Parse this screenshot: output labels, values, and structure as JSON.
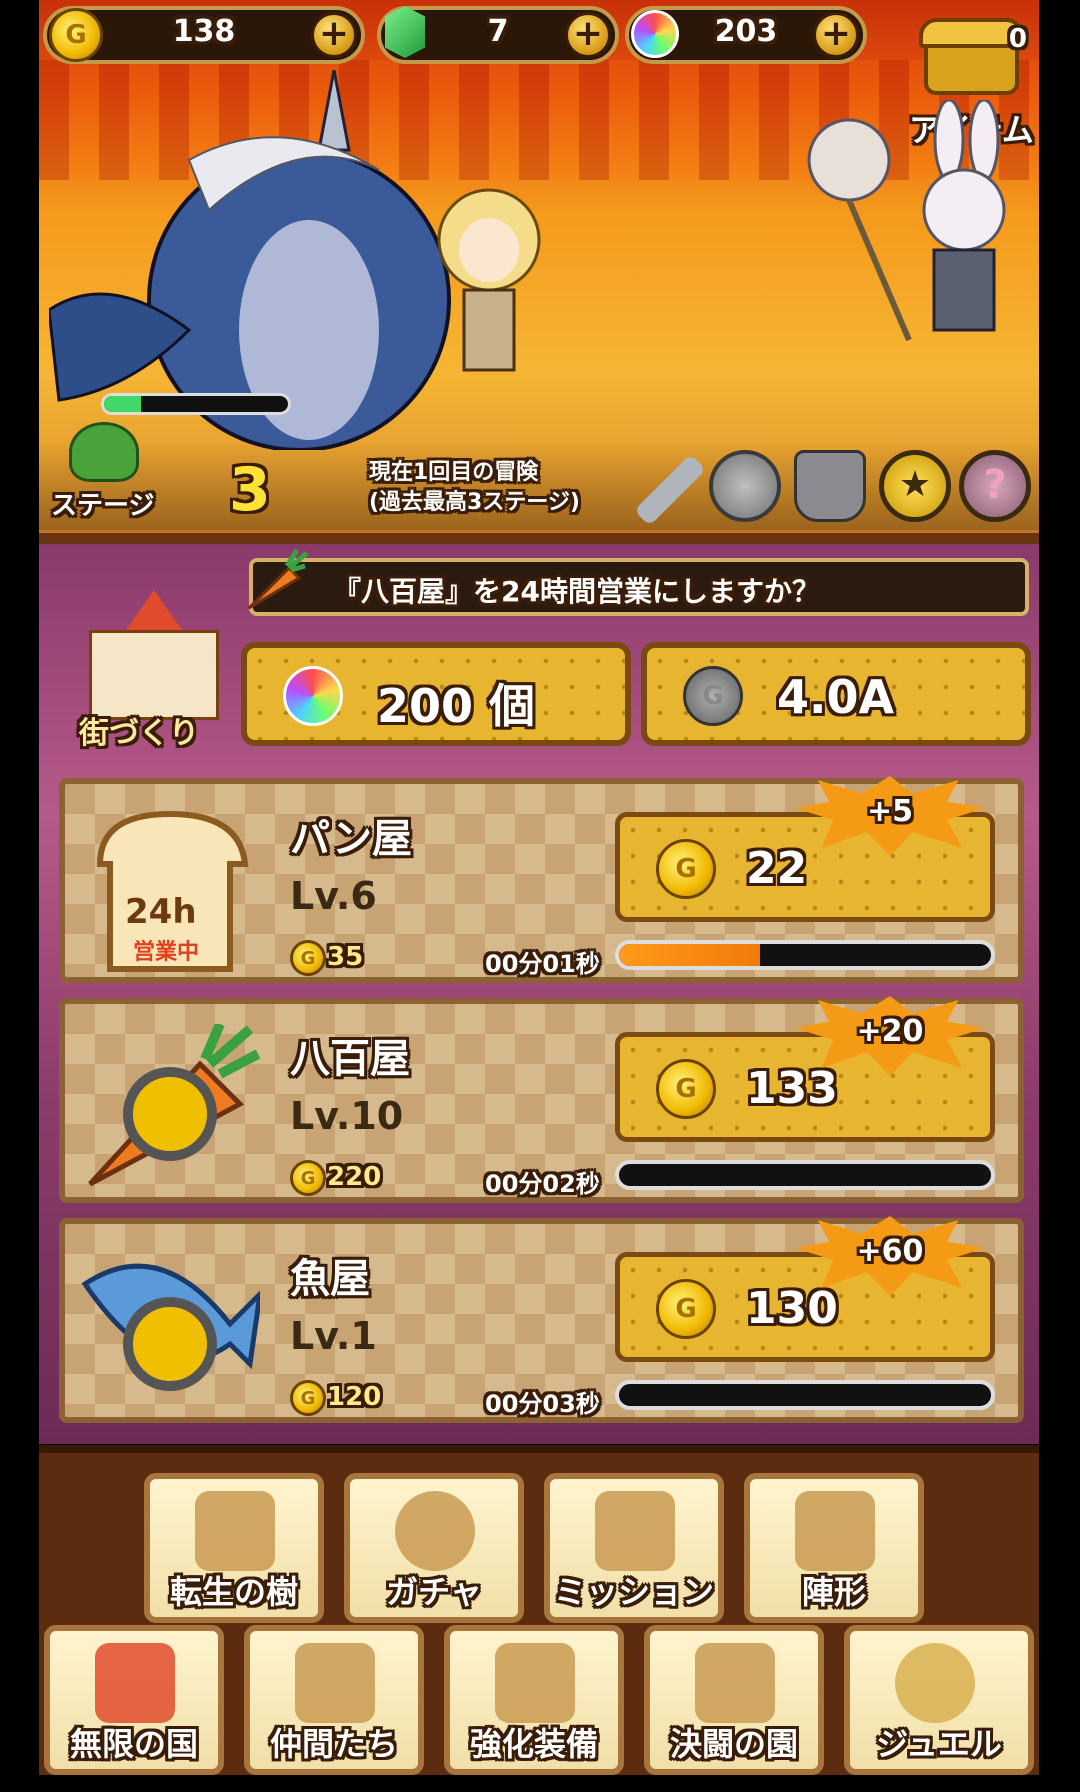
{
  "currency": {
    "coins": "138",
    "gems": "7",
    "rainbow": "203",
    "coin_symbol": "G"
  },
  "chest": {
    "count": "0",
    "label": "アイテム"
  },
  "battle": {
    "stage_label": "ステージ",
    "stage_number": "3",
    "adventure_line1": "現在1回目の冒険",
    "adventure_line2": "(過去最高3ステージ)",
    "monster_hp_fraction": 0.2,
    "tools": [
      "sword-icon",
      "coin-icon",
      "boot-icon",
      "star-icon",
      "question-icon"
    ]
  },
  "town": {
    "label": "街づくり",
    "question": "『八百屋』を24時間営業にしますか？",
    "cost_rainbow": "200 個",
    "cost_coins": "4.0A"
  },
  "shops": [
    {
      "name": "パン屋",
      "level": "Lv.6",
      "upgrade_cost": "35",
      "timer": "00分01秒",
      "earn": "22",
      "bonus": "+5",
      "progress": 0.38,
      "badge_top": "24h",
      "badge_bottom": "営業中"
    },
    {
      "name": "八百屋",
      "level": "Lv.10",
      "upgrade_cost": "220",
      "timer": "00分02秒",
      "earn": "133",
      "bonus": "+20",
      "progress": 0.0
    },
    {
      "name": "魚屋",
      "level": "Lv.1",
      "upgrade_cost": "120",
      "timer": "00分03秒",
      "earn": "130",
      "bonus": "+60",
      "progress": 0.0
    }
  ],
  "menu_top": [
    "転生の樹",
    "ガチャ",
    "ミッション",
    "陣形"
  ],
  "menu_bottom": [
    "無限の国",
    "仲間たち",
    "強化装備",
    "決闘の園",
    "ジュエル"
  ],
  "colors": {
    "accent": "#e8b530",
    "frame": "#7a4a10",
    "progress": "#f07a0a",
    "hp": "#41d86a"
  }
}
